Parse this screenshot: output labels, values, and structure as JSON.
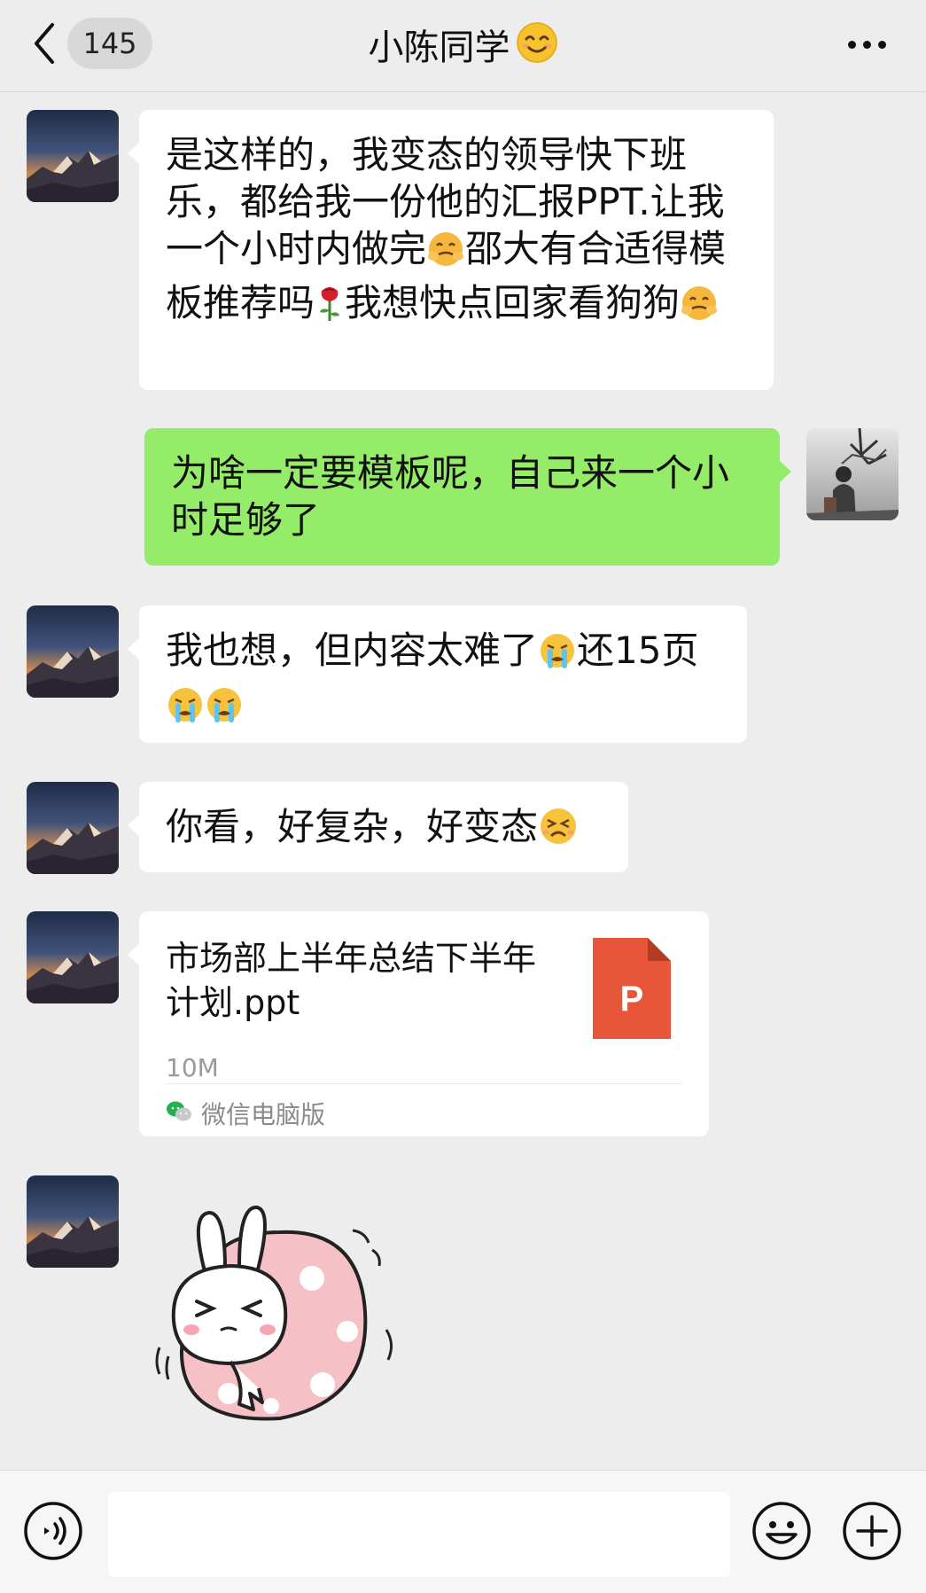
{
  "header": {
    "back_count": "145",
    "title": "小陈同学",
    "title_emoji": "smiling-face"
  },
  "messages": [
    {
      "from": "them",
      "segments": [
        "是这样的，我变态的领导快下班乐，都给我一份他的汇报PPT.让我一个小时内做完",
        "邵大有合适得模板推荐吗",
        "我想快点回家看狗狗"
      ],
      "emojis": [
        "hot-face",
        "rose",
        "hot-face"
      ]
    },
    {
      "from": "me",
      "text": "为啥一定要模板呢，自己来一个小时足够了"
    },
    {
      "from": "them",
      "segments": [
        "我也想，但内容太难了",
        "还15页"
      ],
      "emojis": [
        "crying-face",
        "crying-face",
        "crying-face"
      ]
    },
    {
      "from": "them",
      "text": "你看，好复杂，好变态",
      "emojis": [
        "persevering-face"
      ]
    },
    {
      "from": "them",
      "type": "file",
      "file_name": "市场部上半年总结下半年计划.ppt",
      "file_size": "10M",
      "file_icon_letter": "P",
      "source": "微信电脑版"
    },
    {
      "from": "them",
      "type": "sticker",
      "sticker": "bunny-squeezing-sticker"
    }
  ],
  "input": {
    "value": "",
    "voice_icon": "voice-icon",
    "emoji_icon": "emoji-icon",
    "plus_icon": "plus-icon"
  },
  "colors": {
    "background": "#ededed",
    "bubble_out": "#95ec69",
    "bubble_in": "#ffffff",
    "ppt_icon": "#e8563a"
  }
}
